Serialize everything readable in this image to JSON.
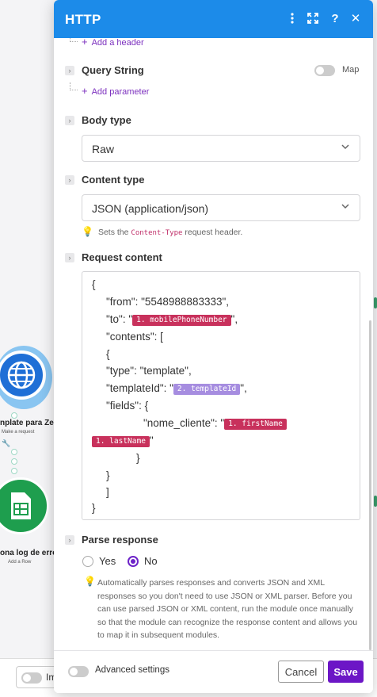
{
  "panel": {
    "title": "HTTP",
    "header_icons": [
      "more-vert-icon",
      "expand-icon",
      "help-icon",
      "close-icon"
    ]
  },
  "headers": {
    "add_label": "Add a header"
  },
  "query_string": {
    "label": "Query String",
    "map_label": "Map",
    "map_enabled": false,
    "add_label": "Add parameter"
  },
  "body_type": {
    "label": "Body type",
    "value": "Raw"
  },
  "content_type": {
    "label": "Content type",
    "value": "JSON (application/json)",
    "hint_prefix": "Sets the",
    "hint_code": "Content-Type",
    "hint_suffix": "request header."
  },
  "request_content": {
    "label": "Request content",
    "lines": {
      "l1": "{",
      "l2": "\"from\": \"5548988883333\",",
      "l3_pre": "\"to\": \"",
      "l3_pill": "1. mobilePhoneNumber",
      "l3_post": "\",",
      "l4": "\"contents\": [",
      "l5": "{",
      "l6": "\"type\": \"template\",",
      "l7_pre": "\"templateId\": \"",
      "l7_pill": "2. templateId",
      "l7_post": "\",",
      "l8": "\"fields\": {",
      "l9_pre": "\"nome_cliente\": \"",
      "l9_pill": "1. firstName",
      "l10_pill": "1. lastName",
      "l10_post": "\"",
      "l11": "}",
      "l12": "}",
      "l13": "]",
      "l14": "}"
    }
  },
  "parse_response": {
    "label": "Parse response",
    "options": [
      "Yes",
      "No"
    ],
    "selected": "No",
    "description": "Automatically parses responses and converts JSON and XML responses so you don't need to use JSON or XML parser. Before you can use parsed JSON or XML content, run the module once manually so that the module can recognize the response content and allows you to map it in subsequent modules."
  },
  "footer": {
    "advanced_label": "Advanced settings",
    "advanced_enabled": false,
    "cancel_label": "Cancel",
    "save_label": "Save"
  },
  "background": {
    "http_node_label": "nplate para Ze",
    "http_node_sub": "Make a request",
    "sheets_node_label": "ona log de erro",
    "sheets_node_sub": "Add a Row",
    "bottom_toggle_label": "Im"
  },
  "colors": {
    "header": "#1c8be9",
    "accent": "#6c16c6",
    "pill_red": "#c8315c",
    "pill_purple": "#a68de0"
  }
}
